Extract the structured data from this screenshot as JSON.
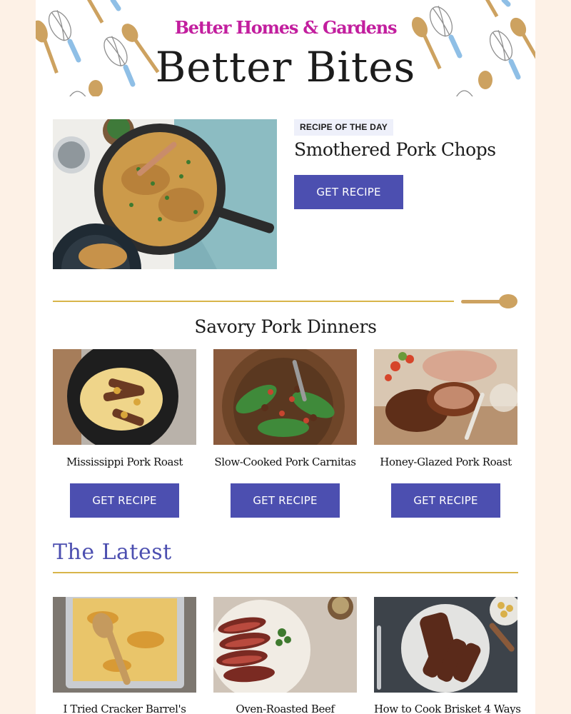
{
  "header": {
    "brand": "Better Homes & Gardens",
    "title": "Better Bites"
  },
  "recipe_of_day": {
    "badge": "RECIPE OF THE DAY",
    "title": "Smothered Pork Chops",
    "button": "GET RECIPE"
  },
  "section": {
    "title": "Savory Pork Dinners",
    "cards": [
      {
        "title": "Mississippi Pork Roast",
        "button": "GET RECIPE"
      },
      {
        "title": "Slow-Cooked Pork Carnitas",
        "button": "GET RECIPE"
      },
      {
        "title": "Honey-Glazed Pork Roast",
        "button": "GET RECIPE"
      }
    ]
  },
  "latest": {
    "title": "The Latest",
    "items": [
      {
        "title": "I Tried Cracker Barrel's"
      },
      {
        "title": "Oven-Roasted Beef"
      },
      {
        "title": "How to Cook Brisket 4 Ways"
      }
    ]
  },
  "colors": {
    "page_background": "#fdf1e6",
    "brand": "#c21e9e",
    "button": "#4c4fb0",
    "accent_gold": "#d8b54a",
    "badge_background": "#eef0fa"
  }
}
